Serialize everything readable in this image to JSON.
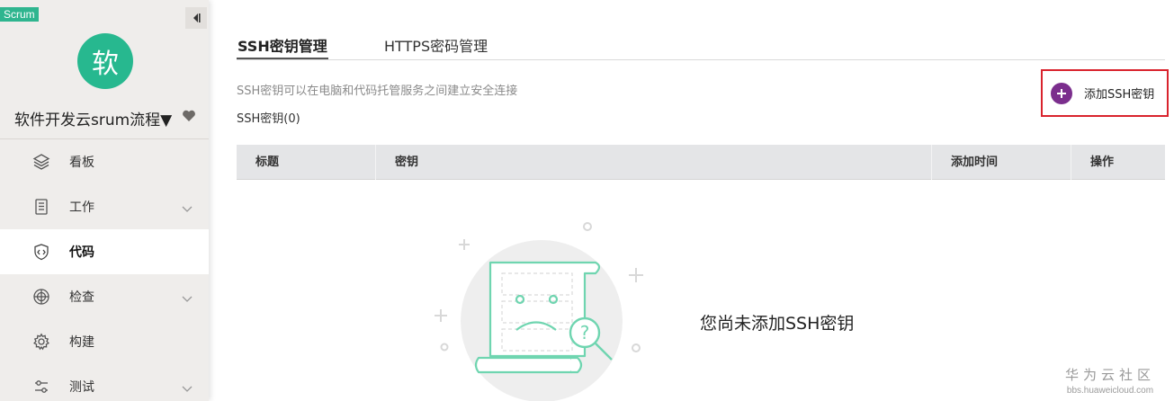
{
  "sidebar": {
    "badge": "Scrum",
    "avatar_char": "软",
    "project_name": "软件开发云srum流程▼",
    "items": [
      {
        "label": "看板",
        "icon": "layers-icon",
        "active": false,
        "has_chevron": false
      },
      {
        "label": "工作",
        "icon": "document-list-icon",
        "active": false,
        "has_chevron": true
      },
      {
        "label": "代码",
        "icon": "code-shield-icon",
        "active": true,
        "has_chevron": false
      },
      {
        "label": "检查",
        "icon": "radar-icon",
        "active": false,
        "has_chevron": true
      },
      {
        "label": "构建",
        "icon": "gear-icon",
        "active": false,
        "has_chevron": false
      },
      {
        "label": "测试",
        "icon": "test-switch-icon",
        "active": false,
        "has_chevron": true
      }
    ]
  },
  "tabs": {
    "ssh": "SSH密钥管理",
    "https": "HTTPS密码管理"
  },
  "main": {
    "description": "SSH密钥可以在电脑和代码托管服务之间建立安全连接",
    "count_label": "SSH密钥(0)",
    "add_button": "添加SSH密钥",
    "table_headers": {
      "title": "标题",
      "key": "密钥",
      "added_time": "添加时间",
      "actions": "操作"
    },
    "empty_text": "您尚未添加SSH密钥"
  },
  "watermark": {
    "title": "华为云社区",
    "url": "bbs.huaweicloud.com"
  },
  "colors": {
    "accent_green": "#2fb58f",
    "add_icon_purple": "#7b2e8d",
    "highlight_red": "#d9232d"
  }
}
